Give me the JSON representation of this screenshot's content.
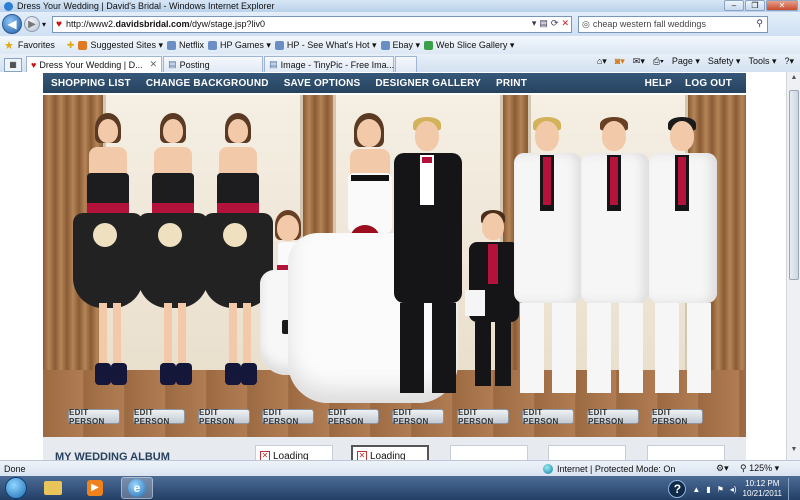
{
  "window": {
    "title": "Dress Your Wedding | David's Bridal - Windows Internet Explorer"
  },
  "address": {
    "url_prefix": "http://www2.",
    "url_domain": "davidsbridal.com",
    "url_suffix": "/dyw/stage.jsp?liv0"
  },
  "search": {
    "value": "cheap western fall weddings"
  },
  "favorites": {
    "label": "Favorites",
    "items": [
      "Suggested Sites ▾",
      "Netflix",
      "HP Games ▾",
      "HP - See What's Hot ▾",
      "Ebay ▾",
      "Web Slice Gallery ▾"
    ]
  },
  "tabs": [
    {
      "label": "Dress Your Wedding | D...",
      "active": true
    },
    {
      "label": "Posting",
      "active": false
    },
    {
      "label": "Image - TinyPic - Free Ima...",
      "active": false
    }
  ],
  "commands": [
    "Page ▾",
    "Safety ▾",
    "Tools ▾"
  ],
  "site_nav": {
    "left": [
      "SHOPPING LIST",
      "CHANGE BACKGROUND",
      "SAVE OPTIONS",
      "DESIGNER GALLERY",
      "PRINT"
    ],
    "right": [
      "HELP",
      "LOG OUT"
    ]
  },
  "edit_label": "EDIT PERSON",
  "album": {
    "label": "MY WEDDING ALBUM",
    "loading1": "Loading",
    "loading2": "Loading"
  },
  "status": {
    "left": "Done",
    "zone": "Internet | Protected Mode: On",
    "zoom": "125%"
  },
  "clock": {
    "time": "10:12 PM",
    "date": "10/21/2011"
  },
  "colors": {
    "nav_bg": "#2e4d6e",
    "accent_red": "#b3123a"
  }
}
